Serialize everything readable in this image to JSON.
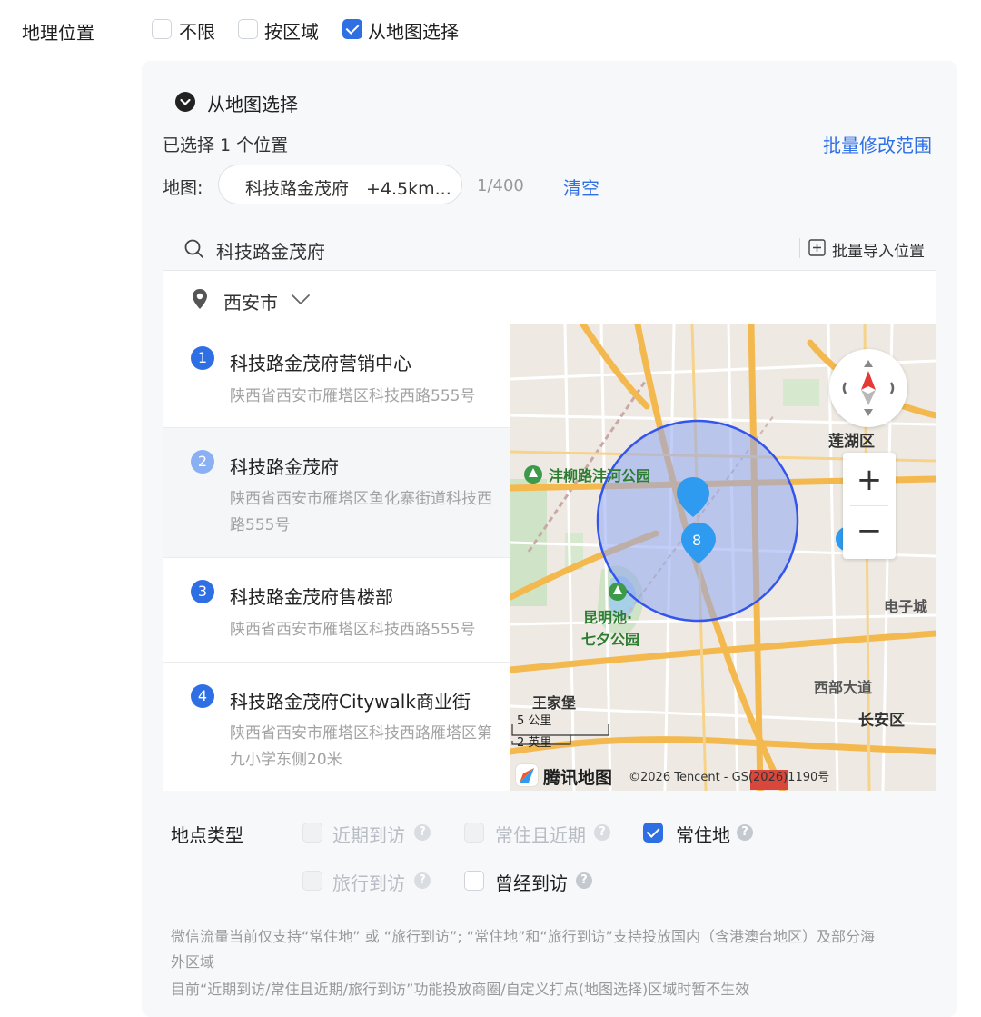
{
  "geo": {
    "label": "地理位置",
    "options": [
      {
        "label": "不限",
        "checked": false
      },
      {
        "label": "按区域",
        "checked": false
      },
      {
        "label": "从地图选择",
        "checked": true
      }
    ]
  },
  "panel": {
    "section_title": "从地图选择",
    "selected_count_text": "已选择 1 个位置",
    "batch_modify_label": "批量修改范围",
    "map_label": "地图:",
    "chip_text": "科技路金茂府　+4.5km...",
    "chip_counter": "1/400",
    "clear_label": "清空",
    "search": {
      "value": "科技路金茂府",
      "batch_import_label": "批量导入位置"
    },
    "city": "西安市",
    "results": [
      {
        "num": "1",
        "name": "科技路金茂府营销中心",
        "addr": "陕西省西安市雁塔区科技西路555号",
        "active": false
      },
      {
        "num": "2",
        "name": "科技路金茂府",
        "addr": "陕西省西安市雁塔区鱼化寨街道科技西路555号",
        "active": true
      },
      {
        "num": "3",
        "name": "科技路金茂府售楼部",
        "addr": "陕西省西安市雁塔区科技西路555号",
        "active": false
      },
      {
        "num": "4",
        "name": "科技路金茂府Citywalk商业街",
        "addr": "陕西省西安市雁塔区科技西路雁塔区第九小学东侧20米",
        "active": false
      }
    ],
    "map": {
      "labels": {
        "lianhu": "莲湖区",
        "park1": "沣柳路沣河公园",
        "kunming": "昆明池·",
        "qixi": "七夕公园",
        "dianzi": "电子城",
        "xibu": "西部大道",
        "wangjia": "王家堡",
        "changan": "长安区"
      },
      "marker_count": "8",
      "zoom_in": "+",
      "zoom_out": "−",
      "scale_km": "5 公里",
      "scale_mi": "2 英里",
      "brand": "腾讯地图",
      "copyright": "©2026 Tencent - GS(2026)1190号"
    }
  },
  "place_type": {
    "label": "地点类型",
    "options": [
      {
        "label": "近期到访",
        "state": "disabled"
      },
      {
        "label": "常住且近期",
        "state": "disabled"
      },
      {
        "label": "常住地",
        "state": "checked"
      },
      {
        "label": "旅行到访",
        "state": "disabled"
      },
      {
        "label": "曾经到访",
        "state": "unchecked"
      }
    ]
  },
  "notes": {
    "line1a": "微信流量当前仅支持“常住地” 或 “旅行到访”; “常住地”和“旅行到访”支持投放国内（含港澳台地区）及部分海",
    "line1b": "外区域",
    "line2": "目前“近期到访/常住且近期/旅行到访”功能投放商圈/自定义打点(地图选择)区域时暂不生效"
  },
  "colors": {
    "accent": "#2f6fe4",
    "marker": "#2e9bf0",
    "circle_fill": "#8fa6f2",
    "circle_stroke": "#3355ee",
    "road": "#f3b94f"
  }
}
